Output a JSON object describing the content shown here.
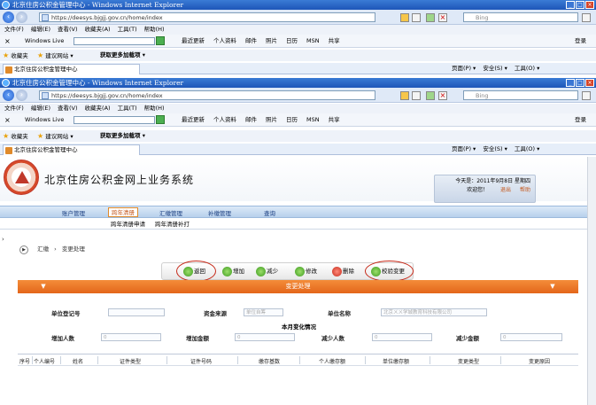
{
  "window1": {
    "title": "北京住房公积金管理中心 - Windows Internet Explorer",
    "url": "https://deesys.bjgjj.gov.cn/home/index",
    "search_placeholder": "Bing"
  },
  "window2": {
    "title": "北京住房公积金管理中心 - Windows Internet Explorer",
    "url": "https://deesys.bjgjj.gov.cn/home/index",
    "search_placeholder": "Bing"
  },
  "menu": [
    "文件(F)",
    "编辑(E)",
    "查看(V)",
    "收藏夹(A)",
    "工具(T)",
    "帮助(H)"
  ],
  "windows_live": {
    "label": "Windows Live",
    "items": [
      "最近更新",
      "个人资料",
      "邮件",
      "照片",
      "日历",
      "MSN",
      "共享"
    ],
    "login": "登录"
  },
  "favorites": {
    "label": "收藏夹",
    "suggested": "建议网站 ▾",
    "addons": "获取更多加载项 ▾"
  },
  "tab": {
    "label": "北京住房公积金管理中心"
  },
  "page_tools": [
    "页面(P) ▾",
    "安全(S) ▾",
    "工具(O) ▾"
  ],
  "header": {
    "system_title": "北京住房公积金网上业务系统",
    "today": "今天是：2011年9月8日 星期四",
    "welcome": "欢迎您！",
    "logout": "退出",
    "help": "帮助"
  },
  "nav": [
    "账户管理",
    "跨年清册",
    "汇缴管理",
    "补缴管理",
    "查询"
  ],
  "subnav": [
    "跨年清册申请",
    "跨年清册补打"
  ],
  "breadcrumb": {
    "a": "汇缴",
    "b": "变更处理"
  },
  "toolbar": {
    "back": "返回",
    "add": "增加",
    "reduce": "减少",
    "edit": "修改",
    "delete": "删除",
    "verify": "校验变更"
  },
  "panel_title": "变更处理",
  "form": {
    "unit_reg_no_label": "单位登记号",
    "unit_reg_no_value": "",
    "fund_source_label": "资金来源",
    "fund_source_value": "单位自筹",
    "unit_name_label": "单位名称",
    "unit_name_value": "北京ㄨㄨ学城教育科技有限公司",
    "month_section": "本月变化情况",
    "add_count_label": "增加人数",
    "add_count_value": "0",
    "add_amount_label": "增加金额",
    "add_amount_value": "0",
    "reduce_count_label": "减少人数",
    "reduce_count_value": "0",
    "reduce_amount_label": "减少金额",
    "reduce_amount_value": "0"
  },
  "grid_columns": [
    "序号",
    "个人编号",
    "姓名",
    "证件类型",
    "证件号码",
    "缴存基数",
    "个人缴存额",
    "单位缴存额",
    "变更类型",
    "变更原因"
  ],
  "colors": {
    "orange": "#e3661a",
    "ie_blue": "#1e56b8",
    "ring_red": "#c62a1a"
  }
}
